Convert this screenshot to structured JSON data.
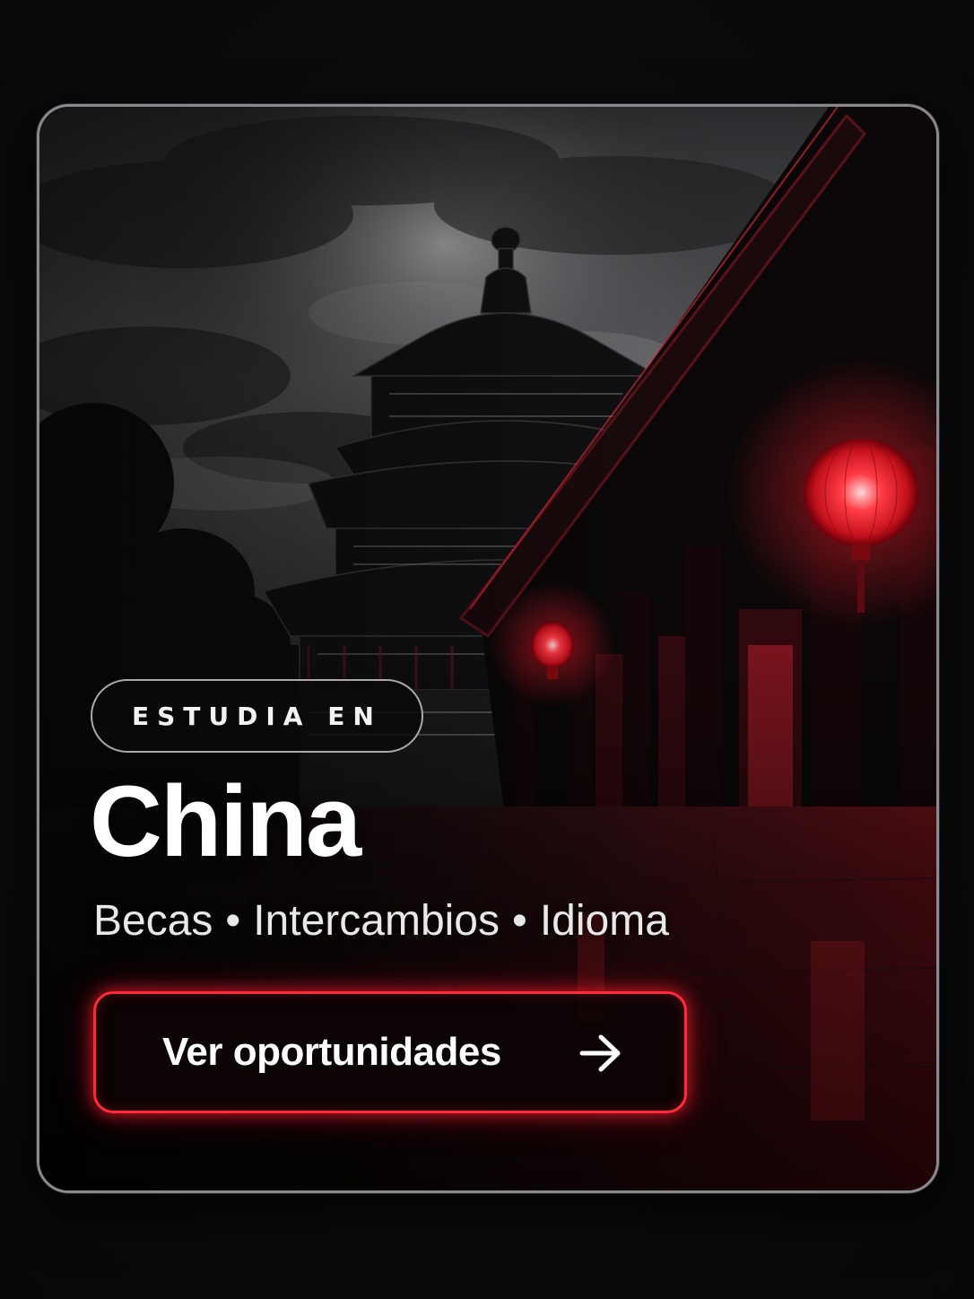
{
  "card": {
    "eyebrow": "ESTUDIA EN",
    "title": "China",
    "subtitle": {
      "items": [
        "Becas",
        "Intercambios",
        "Idioma"
      ],
      "separator": "•"
    },
    "cta": {
      "label": "Ver oportunidades",
      "icon": "arrow-right-icon"
    }
  },
  "colors": {
    "accent": "#ff2a3a",
    "lantern_glow": "#ff1a2a",
    "background": "#0b0b0c",
    "text": "#ffffff"
  }
}
